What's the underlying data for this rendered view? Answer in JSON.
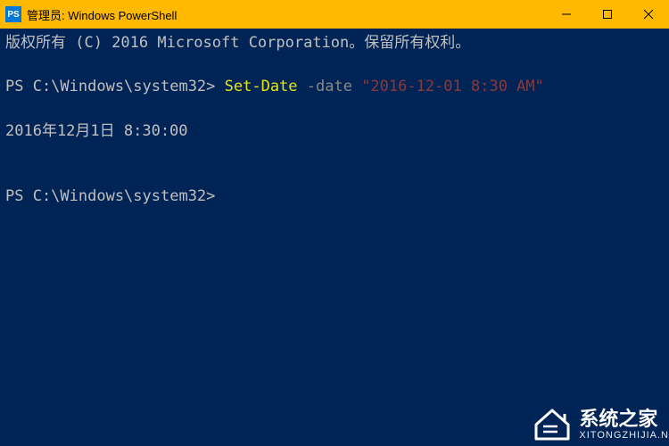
{
  "titlebar": {
    "icon_label": "PS",
    "title": "管理员: Windows PowerShell"
  },
  "terminal": {
    "copyright": "版权所有 (C) 2016 Microsoft Corporation。保留所有权利。",
    "prompt1_prefix": "PS C:\\Windows\\system32> ",
    "cmd_setdate": "Set-Date",
    "cmd_flag": " -date ",
    "cmd_arg": "\"2016-12-01 8:30 AM\"",
    "output": "2016年12月1日 8:30:00",
    "prompt2": "PS C:\\Windows\\system32>"
  },
  "watermark": {
    "main": "系统之家",
    "sub": "XITONGZHIJIA.N"
  }
}
